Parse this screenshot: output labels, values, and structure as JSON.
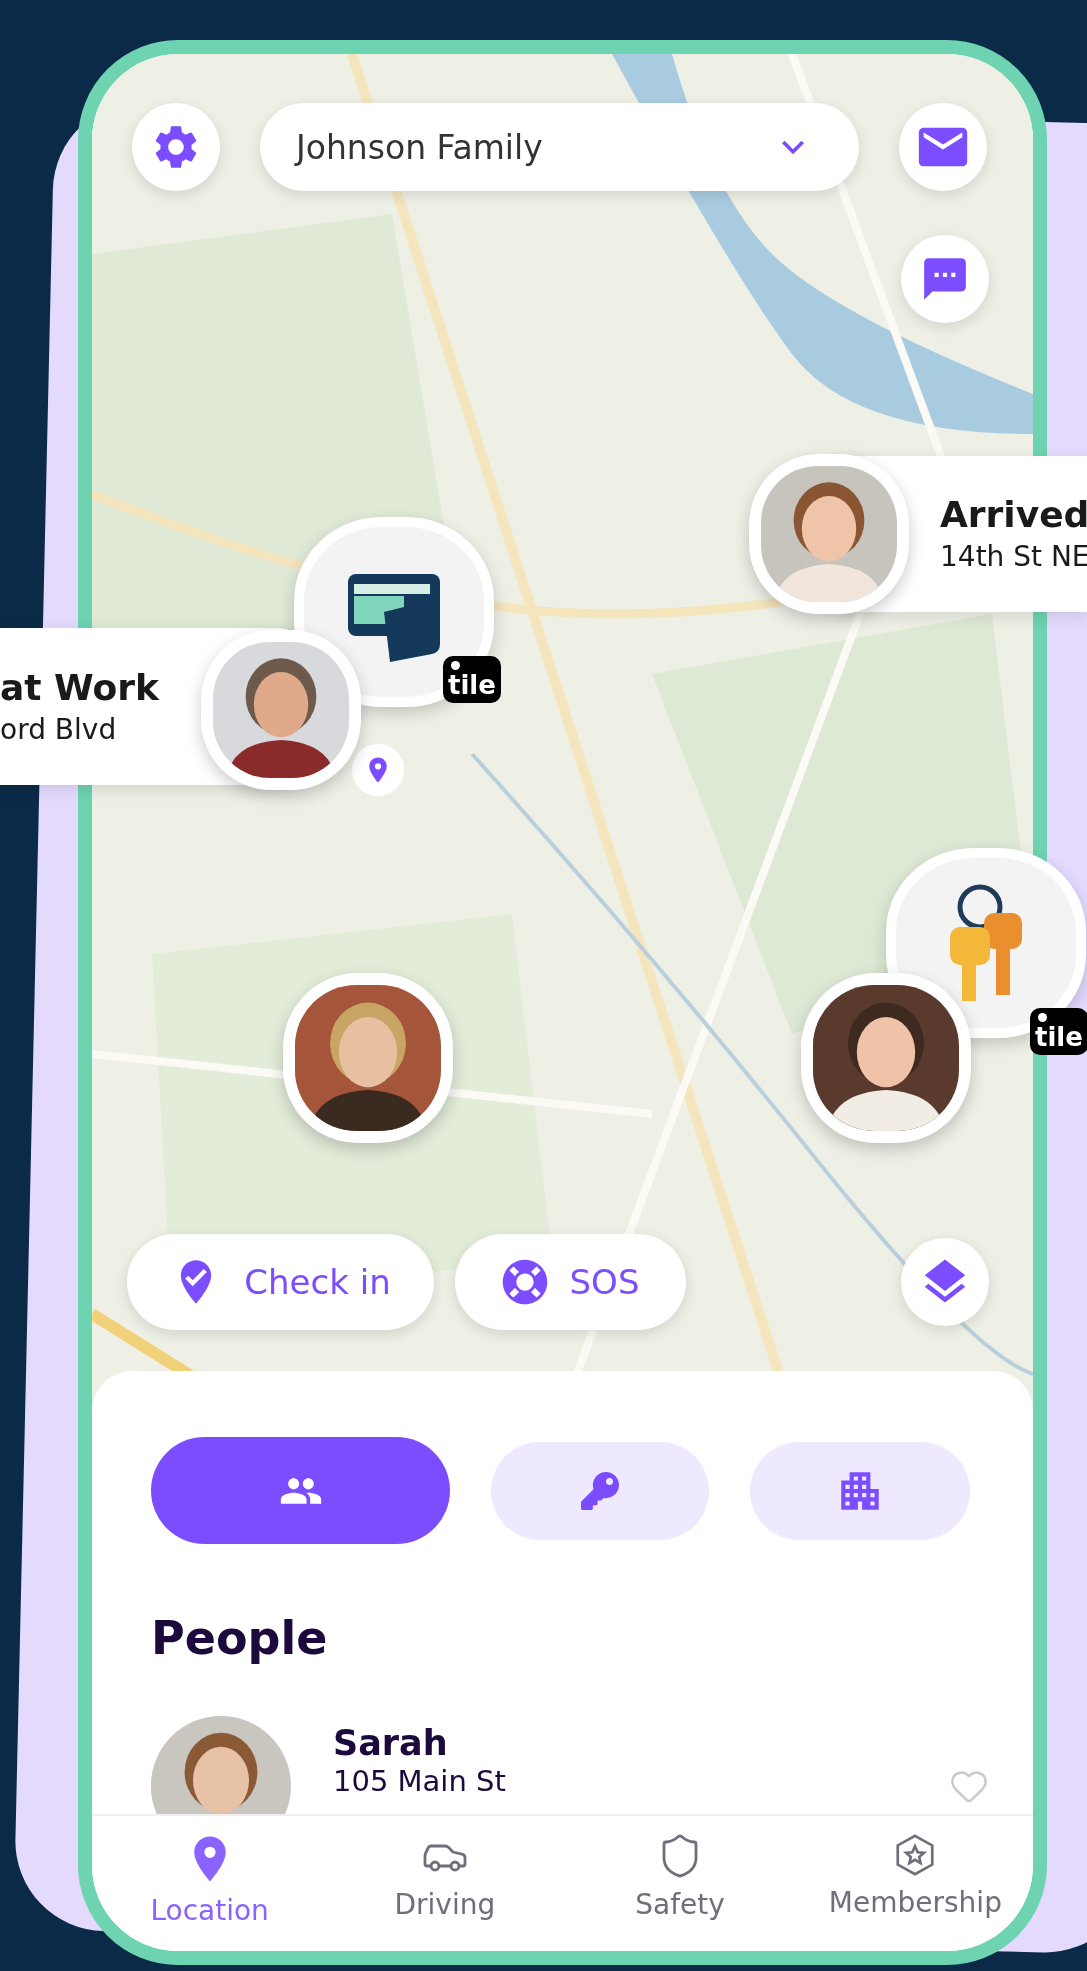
{
  "header": {
    "group": "Johnson Family"
  },
  "callouts": [
    {
      "status": "at Work",
      "address": "ord Blvd"
    },
    {
      "status": "Arrived",
      "address": "14th St NE"
    }
  ],
  "tile_badges": [
    "tile",
    "tile"
  ],
  "actions": [
    {
      "kind": "check-in",
      "label": "Check in"
    },
    {
      "kind": "sos",
      "label": "SOS"
    }
  ],
  "segments": [
    {
      "kind": "people",
      "selected": true
    },
    {
      "kind": "items",
      "selected": false
    },
    {
      "kind": "places",
      "selected": false
    }
  ],
  "section_title": "People",
  "people": [
    {
      "name": "Sarah",
      "address": "105 Main St"
    }
  ],
  "tabs": [
    {
      "kind": "location",
      "label": "Location",
      "selected": true
    },
    {
      "kind": "driving",
      "label": "Driving",
      "selected": false
    },
    {
      "kind": "safety",
      "label": "Safety",
      "selected": false
    },
    {
      "kind": "membership",
      "label": "Membership",
      "selected": false
    }
  ]
}
